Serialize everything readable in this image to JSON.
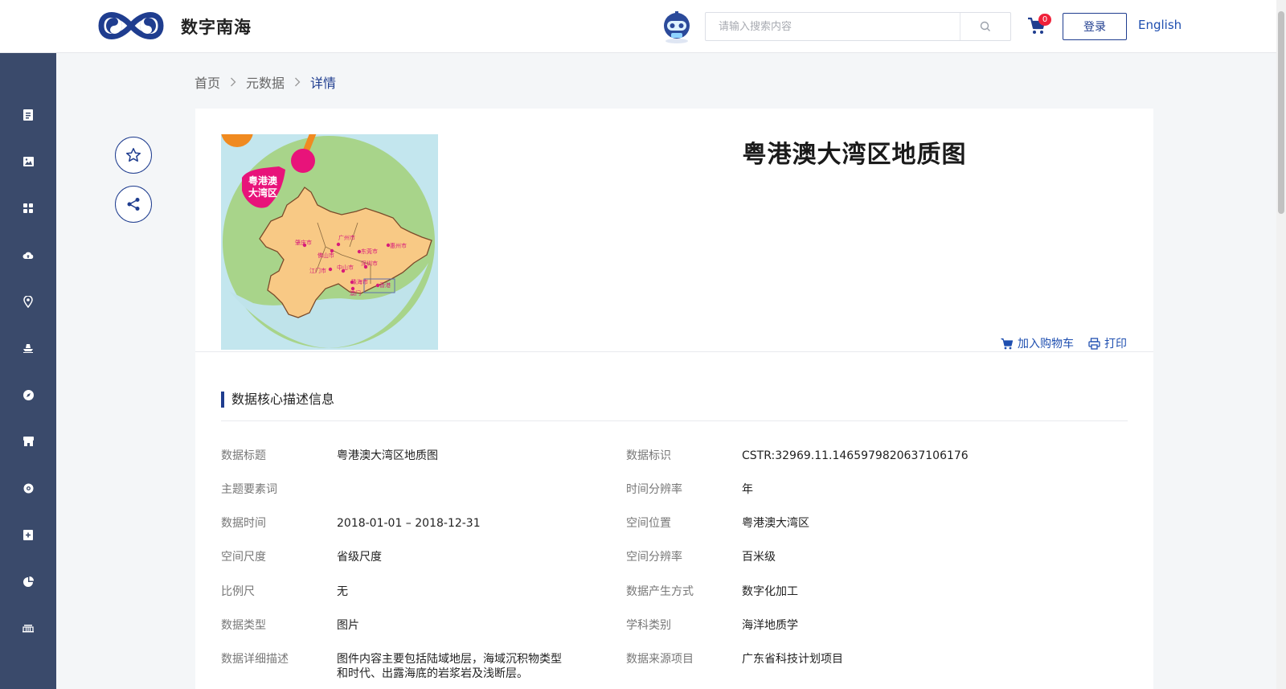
{
  "header": {
    "site_name": "数字南海",
    "search_placeholder": "请输入搜索内容",
    "cart_count": "0",
    "login_label": "登录",
    "language_label": "English"
  },
  "sidebar": {
    "icons": [
      "document-icon",
      "image-icon",
      "grid-icon",
      "cloud-upload-icon",
      "location-icon",
      "ship-icon",
      "compass-icon",
      "store-icon",
      "globe-icon",
      "plus-square-icon",
      "pie-chart-icon",
      "bridge-icon"
    ]
  },
  "breadcrumb": {
    "items": [
      "首页",
      "元数据",
      "详情"
    ]
  },
  "detail": {
    "title": "粤港澳大湾区地质图",
    "add_to_cart": "加入购物车",
    "print": "打印",
    "thumb_labels": {
      "region": "粤港澳\n大湾区",
      "cities": [
        "肇庆市",
        "广州市",
        "佛山市",
        "东莞市",
        "惠州市",
        "江门市",
        "中山市",
        "深圳市",
        "珠海市",
        "香港",
        "澳门"
      ]
    }
  },
  "section": {
    "title": "数据核心描述信息",
    "fields": {
      "left": [
        {
          "label": "数据标题",
          "value": "粤港澳大湾区地质图"
        },
        {
          "label": "主题要素词",
          "value": ""
        },
        {
          "label": "数据时间",
          "value": "2018-01-01 – 2018-12-31"
        },
        {
          "label": "空间尺度",
          "value": "省级尺度"
        },
        {
          "label": "比例尺",
          "value": "无"
        },
        {
          "label": "数据类型",
          "value": "图片"
        },
        {
          "label": "数据详细描述",
          "value": "图件内容主要包括陆域地层，海域沉积物类型\n和时代、出露海底的岩浆岩及浅断层。"
        }
      ],
      "right": [
        {
          "label": "数据标识",
          "value": "CSTR:32969.11.1465979820637106176"
        },
        {
          "label": "时间分辨率",
          "value": "年"
        },
        {
          "label": "空间位置",
          "value": "粤港澳大湾区"
        },
        {
          "label": "空间分辨率",
          "value": "百米级"
        },
        {
          "label": "数据产生方式",
          "value": "数字化加工"
        },
        {
          "label": "学科类别",
          "value": "海洋地质学"
        },
        {
          "label": "数据来源项目",
          "value": "广东省科技计划项目"
        }
      ]
    }
  }
}
